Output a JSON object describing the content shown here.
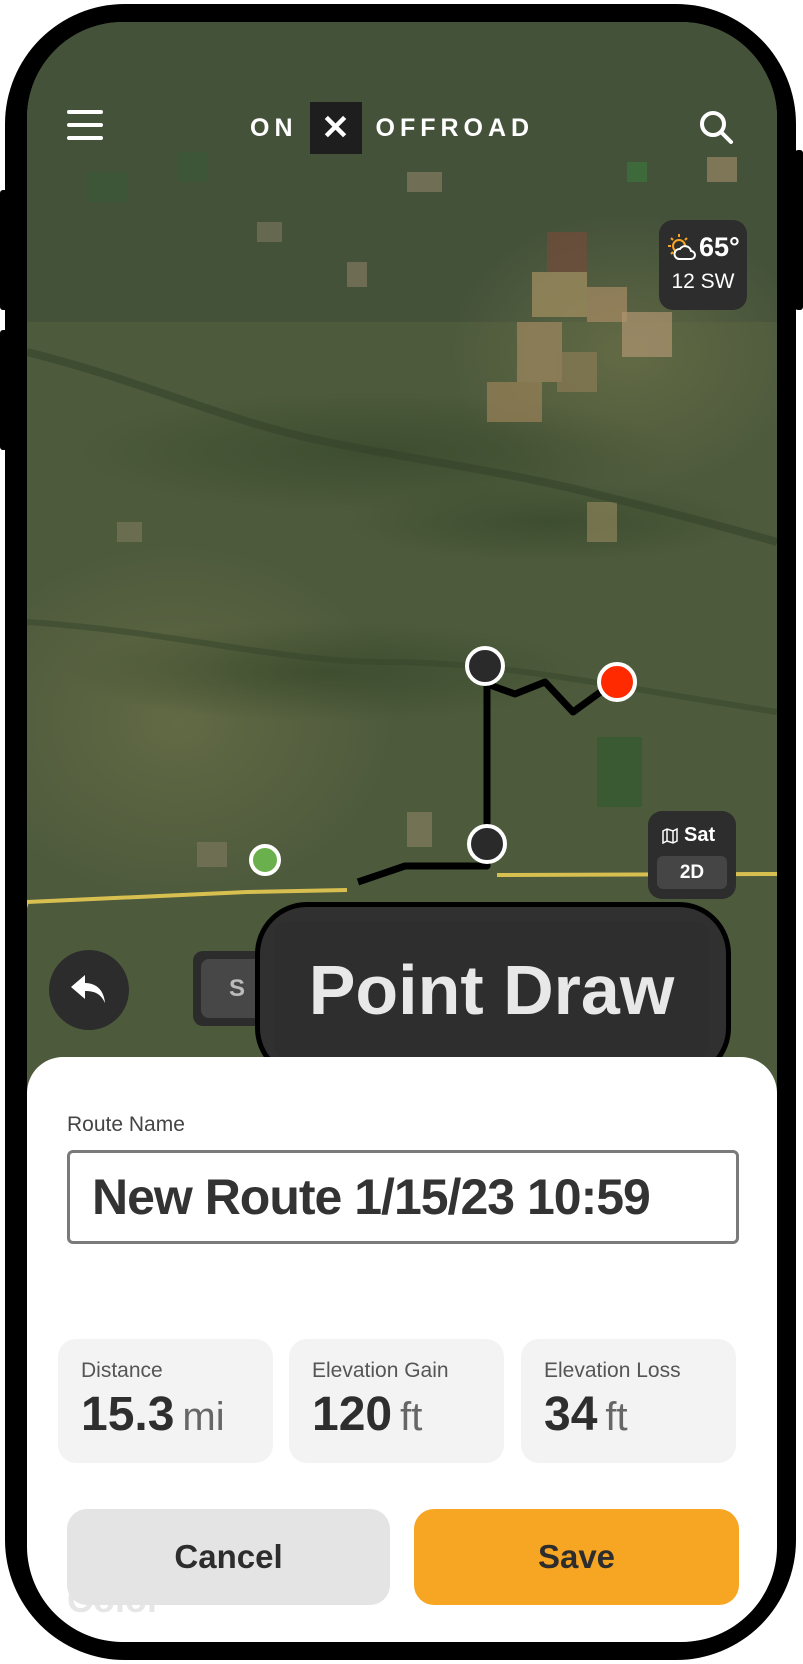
{
  "app": {
    "logo_left": "ON",
    "logo_mark": "✕",
    "logo_right": "OFFROAD"
  },
  "weather": {
    "temperature": "65°",
    "wind": "12 SW"
  },
  "map_layer": {
    "type": "Sat",
    "mode": "2D"
  },
  "tool": {
    "behind_chip_text": "S",
    "tooltip": "Point Draw"
  },
  "route": {
    "name_label": "Route Name",
    "name_value": "New Route 1/15/23 10:59"
  },
  "stats": [
    {
      "label": "Distance",
      "value": "15.3",
      "unit": "mi"
    },
    {
      "label": "Elevation Gain",
      "value": "120",
      "unit": "ft"
    },
    {
      "label": "Elevation Loss",
      "value": "34",
      "unit": "ft"
    }
  ],
  "actions": {
    "cancel": "Cancel",
    "save": "Save",
    "hidden_section": "Color"
  },
  "colors": {
    "accent": "#f7a623",
    "end_point": "#ff2a00",
    "route_line": "#000000",
    "road": "#d8c050"
  }
}
